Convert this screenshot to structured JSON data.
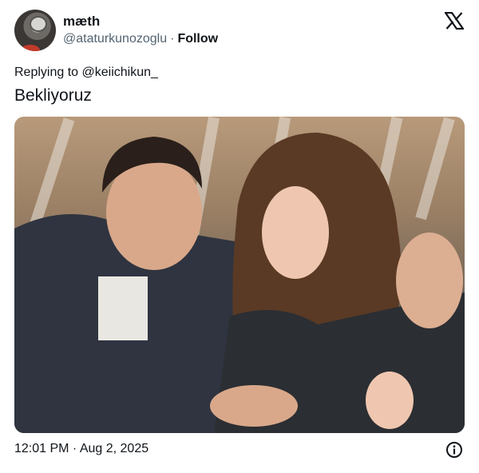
{
  "author": {
    "name": "mæth",
    "handle": "@ataturkunozoglu",
    "separator": "·",
    "follow_label": "Follow"
  },
  "platform_icon": "x-logo-icon",
  "reply": {
    "prefix": "Replying to ",
    "mention": "@keiichikun_"
  },
  "tweet": {
    "text": "Bekliyoruz"
  },
  "media": {
    "type": "photo",
    "description_icon": "photo"
  },
  "footer": {
    "timestamp": "12:01 PM · Aug 2, 2025",
    "info_icon": "info-icon"
  }
}
